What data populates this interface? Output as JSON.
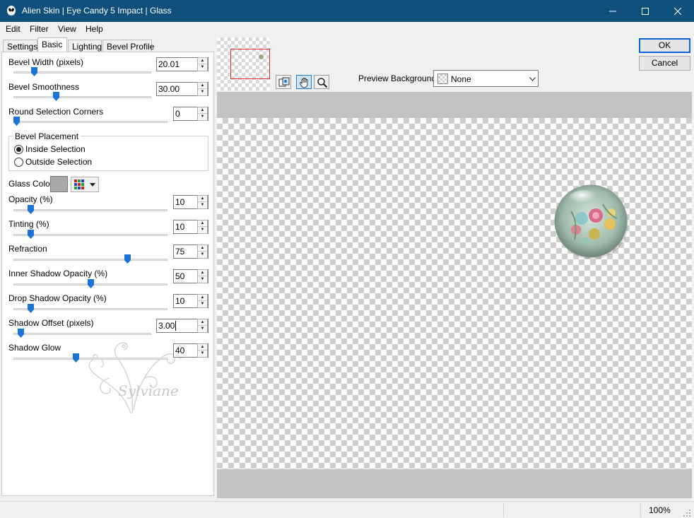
{
  "window": {
    "title": "Alien Skin | Eye Candy 5 Impact | Glass",
    "minimize_glyph": "—",
    "maximize_glyph": "☐",
    "close_glyph": "✕"
  },
  "menu": {
    "items": [
      "Edit",
      "Filter",
      "View",
      "Help"
    ]
  },
  "tabs": [
    "Settings",
    "Basic",
    "Lighting",
    "Bevel Profile"
  ],
  "active_tab": "Basic",
  "controls": {
    "bevel_width": {
      "label": "Bevel Width (pixels)",
      "value": "20.01",
      "level": 0.12
    },
    "bevel_smoothness": {
      "label": "Bevel Smoothness",
      "value": "30.00",
      "level": 0.3
    },
    "round_corners": {
      "label": "Round Selection Corners",
      "value": "0",
      "level": 0.0
    },
    "bevel_placement": {
      "label": "Bevel Placement",
      "options": [
        "Inside Selection",
        "Outside Selection"
      ],
      "selected": "Inside Selection"
    },
    "glass_color": {
      "label": "Glass Color",
      "color": "#a8a8a8"
    },
    "opacity": {
      "label": "Opacity (%)",
      "value": "10",
      "level": 0.1
    },
    "tinting": {
      "label": "Tinting (%)",
      "value": "10",
      "level": 0.1
    },
    "refraction": {
      "label": "Refraction",
      "value": "75",
      "level": 0.75
    },
    "inner_shadow_opacity": {
      "label": "Inner Shadow Opacity (%)",
      "value": "50",
      "level": 0.5
    },
    "drop_shadow_opacity": {
      "label": "Drop Shadow Opacity (%)",
      "value": "10",
      "level": 0.1
    },
    "shadow_offset": {
      "label": "Shadow Offset (pixels)",
      "value": "3.00",
      "level": 0.05
    },
    "shadow_glow": {
      "label": "Shadow Glow",
      "value": "40",
      "level": 0.4
    }
  },
  "watermark_text": "Sylviane",
  "preview": {
    "background_label": "Preview Background:",
    "background_value": "None"
  },
  "buttons": {
    "ok": "OK",
    "cancel": "Cancel"
  },
  "status": {
    "zoom": "100%"
  },
  "colors": {
    "titlebar": "#0e4f7b",
    "accent": "#0a64d6",
    "slider_thumb": "#1a73d6"
  }
}
